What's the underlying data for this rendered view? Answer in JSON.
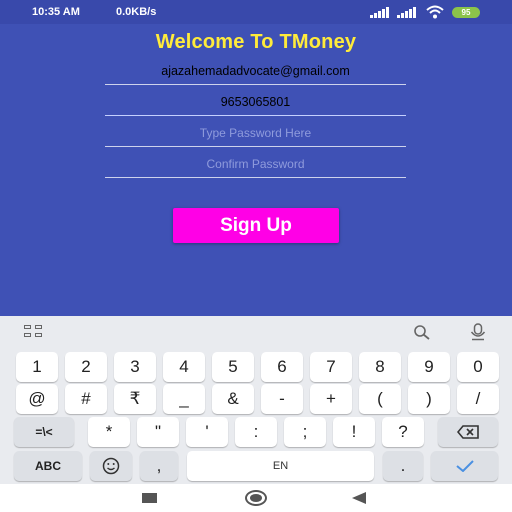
{
  "status_bar": {
    "time": "10:35 AM",
    "network_speed": "0.0KB/s",
    "battery": "95"
  },
  "app": {
    "title": "Welcome To TMoney",
    "fields": {
      "email": {
        "value": "ajazahemadadvocate@gmail.com",
        "placeholder": ""
      },
      "phone": {
        "value": "9653065801",
        "placeholder": ""
      },
      "password": {
        "value": "",
        "placeholder": "Type Password Here"
      },
      "confirm_password": {
        "value": "",
        "placeholder": "Confirm Password"
      }
    },
    "signup_label": "Sign Up",
    "colors": {
      "background": "#3f51b5",
      "title": "#ffeb3b",
      "button": "#ff00e6"
    }
  },
  "keyboard": {
    "row1": [
      "1",
      "2",
      "3",
      "4",
      "5",
      "6",
      "7",
      "8",
      "9",
      "0"
    ],
    "row2": [
      "@",
      "#",
      "₹",
      "_",
      "&",
      "-",
      "+",
      "(",
      ")",
      "/"
    ],
    "row3": [
      "=\\<",
      "*",
      "\"",
      "'",
      ":",
      ";",
      "!",
      "?"
    ],
    "row4": {
      "abc": "ABC",
      "comma": ",",
      "space": "EN",
      "period": "."
    }
  }
}
